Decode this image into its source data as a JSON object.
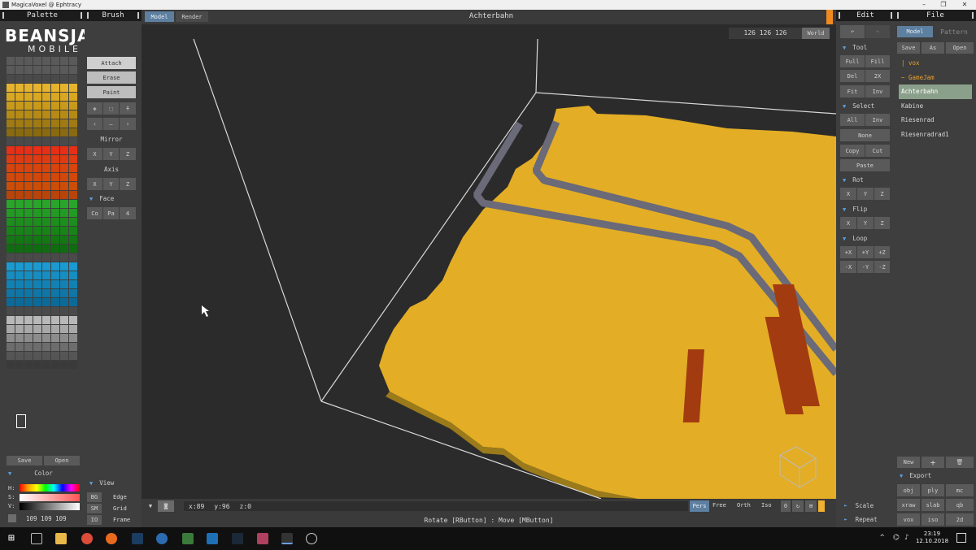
{
  "window": {
    "title": "MagicaVoxel @ Ephtracy"
  },
  "palette": {
    "header": "Palette",
    "save_label": "Save",
    "open_label": "Open",
    "color_header": "Color",
    "hsv": [
      "H:",
      "S:",
      "V:"
    ],
    "rgb_value": "109 109 109",
    "watermark_top": "BEANSJAM",
    "watermark_bottom": "MOBILE",
    "rows": [
      [
        "#5a5a5a",
        "#5a5a5a",
        "#5a5a5a",
        "#5a5a5a",
        "#5a5a5a",
        "#5a5a5a",
        "#5a5a5a",
        "#5a5a5a"
      ],
      [
        "#5a5a5a",
        "#5a5a5a",
        "#5a5a5a",
        "#5a5a5a",
        "#5a5a5a",
        "#5a5a5a",
        "#5a5a5a",
        "#5a5a5a"
      ],
      [
        "#4a4a4a",
        "#4a4a4a",
        "#4a4a4a",
        "#4a4a4a",
        "#4a4a4a",
        "#4a4a4a",
        "#4a4a4a",
        "#4a4a4a"
      ],
      [
        "#e6b32e",
        "#e6b32e",
        "#e6b32e",
        "#e6b32e",
        "#e6b32e",
        "#e6b32e",
        "#e6b32e",
        "#e6b32e"
      ],
      [
        "#d9a822",
        "#d9a822",
        "#d9a822",
        "#d9a822",
        "#d9a822",
        "#d9a822",
        "#d9a822",
        "#d9a822"
      ],
      [
        "#c99a1a",
        "#c99a1a",
        "#c99a1a",
        "#c99a1a",
        "#c99a1a",
        "#c99a1a",
        "#c99a1a",
        "#c99a1a"
      ],
      [
        "#b68b15",
        "#b68b15",
        "#b68b15",
        "#b68b15",
        "#b68b15",
        "#b68b15",
        "#b68b15",
        "#b68b15"
      ],
      [
        "#a07a12",
        "#a07a12",
        "#a07a12",
        "#a07a12",
        "#a07a12",
        "#a07a12",
        "#a07a12",
        "#a07a12"
      ],
      [
        "#8a6a10",
        "#8a6a10",
        "#8a6a10",
        "#8a6a10",
        "#8a6a10",
        "#8a6a10",
        "#8a6a10",
        "#8a6a10"
      ],
      [
        "#4a4a4a",
        "#4a4a4a",
        "#4a4a4a",
        "#4a4a4a",
        "#4a4a4a",
        "#4a4a4a",
        "#4a4a4a",
        "#4a4a4a"
      ],
      [
        "#e52f16",
        "#e52f16",
        "#e52f16",
        "#e52f16",
        "#e52f16",
        "#e52f16",
        "#e52f16",
        "#e52f16"
      ],
      [
        "#de3b12",
        "#de3b12",
        "#de3b12",
        "#de3b12",
        "#de3b12",
        "#de3b12",
        "#de3b12",
        "#de3b12"
      ],
      [
        "#d8440e",
        "#d8440e",
        "#d8440e",
        "#d8440e",
        "#d8440e",
        "#d8440e",
        "#d8440e",
        "#d8440e"
      ],
      [
        "#d2480b",
        "#d2480b",
        "#d2480b",
        "#d2480b",
        "#d2480b",
        "#d2480b",
        "#d2480b",
        "#d2480b"
      ],
      [
        "#cc4d08",
        "#cc4d08",
        "#cc4d08",
        "#cc4d08",
        "#cc4d08",
        "#cc4d08",
        "#cc4d08",
        "#cc4d08"
      ],
      [
        "#b8440a",
        "#b8440a",
        "#b8440a",
        "#b8440a",
        "#b8440a",
        "#b8440a",
        "#b8440a",
        "#b8440a"
      ],
      [
        "#2aa42a",
        "#2aa42a",
        "#2aa42a",
        "#2aa42a",
        "#2aa42a",
        "#2aa42a",
        "#2aa42a",
        "#2aa42a"
      ],
      [
        "#239a23",
        "#239a23",
        "#239a23",
        "#239a23",
        "#239a23",
        "#239a23",
        "#239a23",
        "#239a23"
      ],
      [
        "#1d8e1d",
        "#1d8e1d",
        "#1d8e1d",
        "#1d8e1d",
        "#1d8e1d",
        "#1d8e1d",
        "#1d8e1d",
        "#1d8e1d"
      ],
      [
        "#188418",
        "#188418",
        "#188418",
        "#188418",
        "#188418",
        "#188418",
        "#188418",
        "#188418"
      ],
      [
        "#137813",
        "#137813",
        "#137813",
        "#137813",
        "#137813",
        "#137813",
        "#137813",
        "#137813"
      ],
      [
        "#106c10",
        "#106c10",
        "#106c10",
        "#106c10",
        "#106c10",
        "#106c10",
        "#106c10",
        "#106c10"
      ],
      [
        "#4a4a4a",
        "#4a4a4a",
        "#4a4a4a",
        "#4a4a4a",
        "#4a4a4a",
        "#4a4a4a",
        "#4a4a4a",
        "#4a4a4a"
      ],
      [
        "#1a9ad0",
        "#1a9ad0",
        "#1a9ad0",
        "#1a9ad0",
        "#1a9ad0",
        "#1a9ad0",
        "#1a9ad0",
        "#1a9ad0"
      ],
      [
        "#168ec2",
        "#168ec2",
        "#168ec2",
        "#168ec2",
        "#168ec2",
        "#168ec2",
        "#168ec2",
        "#168ec2"
      ],
      [
        "#1282b4",
        "#1282b4",
        "#1282b4",
        "#1282b4",
        "#1282b4",
        "#1282b4",
        "#1282b4",
        "#1282b4"
      ],
      [
        "#0f76a6",
        "#0f76a6",
        "#0f76a6",
        "#0f76a6",
        "#0f76a6",
        "#0f76a6",
        "#0f76a6",
        "#0f76a6"
      ],
      [
        "#0c6a98",
        "#0c6a98",
        "#0c6a98",
        "#0c6a98",
        "#0c6a98",
        "#0c6a98",
        "#0c6a98",
        "#0c6a98"
      ],
      [
        "#4a4a4a",
        "#4a4a4a",
        "#4a4a4a",
        "#4a4a4a",
        "#4a4a4a",
        "#4a4a4a",
        "#4a4a4a",
        "#4a4a4a"
      ],
      [
        "#b8b8b8",
        "#b8b8b8",
        "#b8b8b8",
        "#b8b8b8",
        "#b8b8b8",
        "#b8b8b8",
        "#b8b8b8",
        "#b8b8b8"
      ],
      [
        "#a8a8a8",
        "#a8a8a8",
        "#a8a8a8",
        "#a8a8a8",
        "#a8a8a8",
        "#a8a8a8",
        "#a8a8a8",
        "#a8a8a8"
      ],
      [
        "#8c8c8c",
        "#8c8c8c",
        "#8c8c8c",
        "#8c8c8c",
        "#8c8c8c",
        "#8c8c8c",
        "#8c8c8c",
        "#8c8c8c"
      ],
      [
        "#6d6d6d",
        "#6d6d6d",
        "#6d6d6d",
        "#6d6d6d",
        "#6d6d6d",
        "#6d6d6d",
        "#6d6d6d",
        "#6d6d6d"
      ],
      [
        "#555555",
        "#555555",
        "#555555",
        "#555555",
        "#555555",
        "#555555",
        "#555555",
        "#555555"
      ],
      [
        "#3a3a3a",
        "#3a3a3a",
        "#3a3a3a",
        "#3a3a3a",
        "#3a3a3a",
        "#3a3a3a",
        "#3a3a3a",
        "#3a3a3a"
      ]
    ]
  },
  "brush": {
    "header": "Brush",
    "modes": [
      "Attach",
      "Erase",
      "Paint"
    ],
    "mirror_label": "Mirror",
    "axis_label": "Axis",
    "xyz": [
      "X",
      "Y",
      "Z"
    ],
    "face_label": "Face",
    "face_buttons": [
      "Co",
      "Pa",
      "4"
    ],
    "view_label": "View",
    "view_rows": [
      {
        "key": "BG",
        "label": "Edge"
      },
      {
        "key": "SM",
        "label": "Grid"
      },
      {
        "key": "IO",
        "label": "Frame"
      }
    ]
  },
  "viewport": {
    "tabs": [
      "Model",
      "Render"
    ],
    "title": "Achterbahn",
    "dimensions": "126  126  126",
    "world_label": "World",
    "coords": [
      "x:89",
      "y:96",
      "z:0"
    ],
    "camera_modes": [
      "Pers",
      "Free",
      "Orth",
      "Iso"
    ],
    "zoom": "0",
    "hint": "Rotate [RButton] : Move [MButton]",
    "colors": {
      "ground": "#e3ad25",
      "ground_edge": "#9a7a1a",
      "rail": "#6a6a78",
      "pillar": "#a33b10",
      "bg": "#2b2b2b"
    }
  },
  "edit": {
    "header": "Edit",
    "tool_label": "Tool",
    "tool_buttons": [
      "Full",
      "Fill",
      "Del",
      "2X",
      "Fit",
      "Inv"
    ],
    "select_label": "Select",
    "select_buttons": [
      "All",
      "Inv"
    ],
    "none_label": "None",
    "copy_label": "Copy",
    "cut_label": "Cut",
    "paste_label": "Paste",
    "rot_label": "Rot",
    "flip_label": "Flip",
    "loop_label": "Loop",
    "xyz": [
      "X",
      "Y",
      "Z"
    ],
    "loop_buttons": [
      "+X",
      "+Y",
      "+Z",
      "-X",
      "-Y",
      "-Z"
    ],
    "scale_label": "Scale",
    "repeat_label": "Repeat"
  },
  "file": {
    "header": "File",
    "tabs": [
      "Model",
      "Pattern"
    ],
    "actions": [
      "Save",
      "As",
      "Open"
    ],
    "items": [
      "| vox",
      "~ GameJam",
      "Achterbahn",
      "Kabine",
      "Riesenrad",
      "Riesenradrad1"
    ],
    "new_label": "New",
    "export_label": "Export",
    "export_buttons": [
      "obj",
      "ply",
      "mc",
      "xraw",
      "slab",
      "qb",
      "vox",
      "iso",
      "2d"
    ]
  },
  "taskbar": {
    "time": "23:19",
    "date": "12.10.2018"
  }
}
